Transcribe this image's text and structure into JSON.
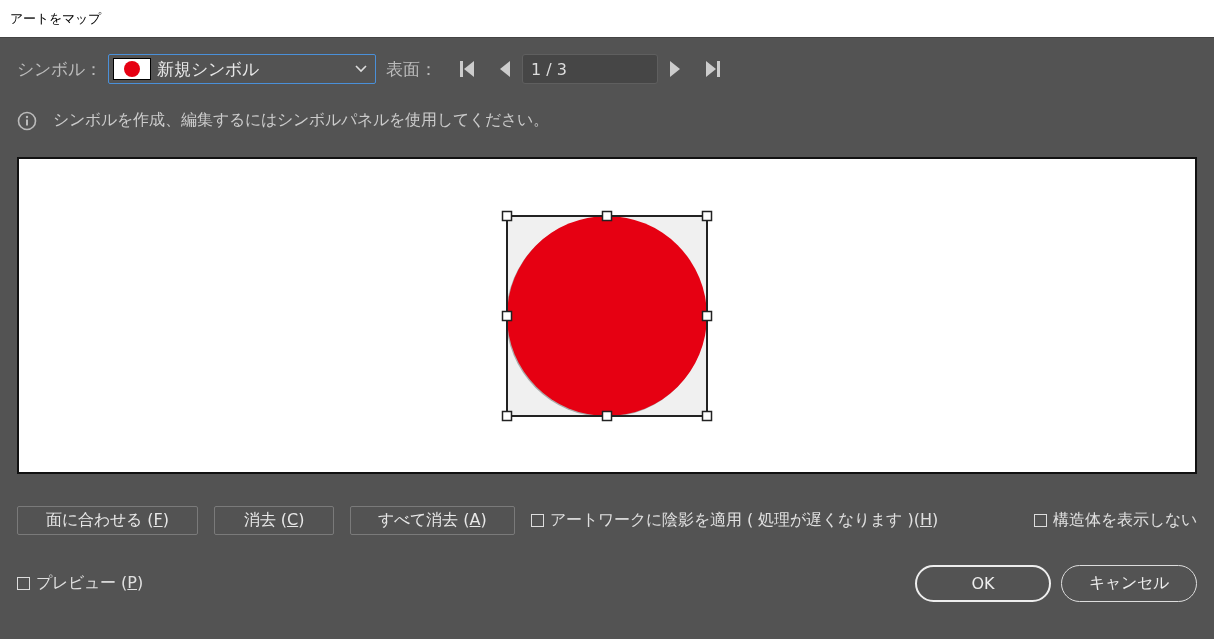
{
  "window": {
    "title": "アートをマップ"
  },
  "symbol": {
    "label": "シンボル：",
    "value": "新規シンボル"
  },
  "surface": {
    "label": "表面：",
    "page": "1 / 3"
  },
  "info": "シンボルを作成、編集するにはシンボルパネルを使用してください。",
  "buttons": [
    {
      "before": "面に合わせる (",
      "key": "F",
      "after": ")"
    },
    {
      "before": "消去 (",
      "key": "C",
      "after": ")"
    },
    {
      "before": "すべて消去 (",
      "key": "A",
      "after": ")"
    }
  ],
  "options": [
    {
      "before": "アートワークに陰影を適用 ( 処理が遅くなります )(",
      "key": "H",
      "after": ")",
      "checked": false
    },
    {
      "before": "構造体を表示しない",
      "checked": false
    }
  ],
  "preview": {
    "before": "プレビュー (",
    "key": "P",
    "after": ")",
    "checked": false
  },
  "dialog_buttons": [
    {
      "label": "OK",
      "default": true
    },
    {
      "label": "キャンセル",
      "default": false
    }
  ]
}
